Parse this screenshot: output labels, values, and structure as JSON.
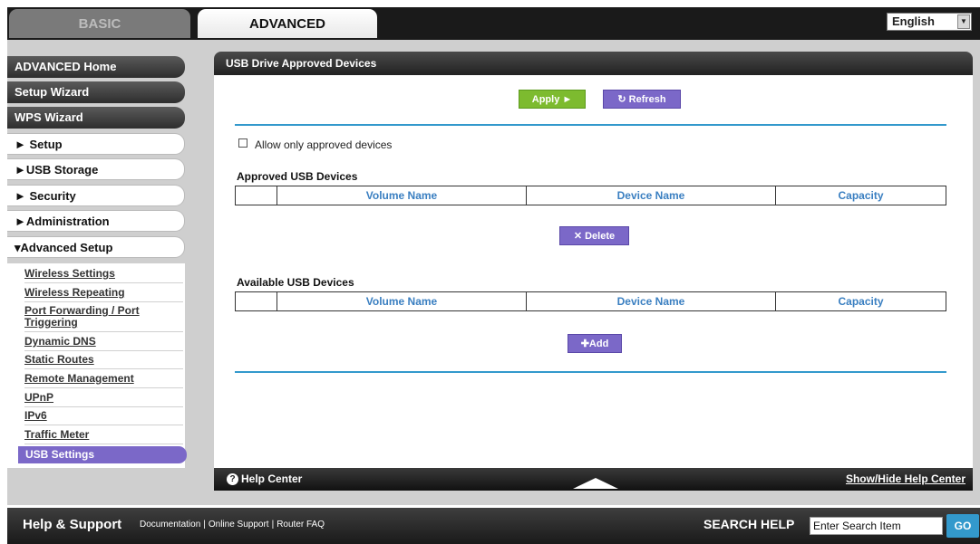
{
  "header": {
    "tabs": [
      {
        "label": "BASIC"
      },
      {
        "label": "ADVANCED"
      }
    ],
    "language": "English"
  },
  "sidebar": {
    "buttons": [
      {
        "label": "ADVANCED Home"
      },
      {
        "label": "Setup Wizard"
      },
      {
        "label": "WPS Wizard"
      },
      {
        "label": "► Setup"
      },
      {
        "label": "►USB Storage"
      },
      {
        "label": "► Security"
      },
      {
        "label": "►Administration"
      },
      {
        "label": "▾Advanced Setup"
      }
    ],
    "subitems": [
      {
        "label": "Wireless Settings"
      },
      {
        "label": "Wireless Repeating"
      },
      {
        "label": "Port Forwarding / Port Triggering"
      },
      {
        "label": "Dynamic DNS"
      },
      {
        "label": "Static Routes"
      },
      {
        "label": "Remote Management"
      },
      {
        "label": "UPnP"
      },
      {
        "label": "IPv6"
      },
      {
        "label": "Traffic Meter"
      },
      {
        "label": "USB Settings"
      }
    ]
  },
  "main": {
    "title": "USB Drive Approved Devices",
    "apply_label": "Apply ►",
    "refresh_label": "↻ Refresh",
    "allow_label": "Allow only approved devices",
    "approved_title": "Approved USB Devices",
    "available_title": "Available USB Devices",
    "columns": [
      "",
      "Volume Name",
      "Device Name",
      "Capacity"
    ],
    "delete_label": "✕ Delete",
    "add_label": "✚Add"
  },
  "help": {
    "label": "Help Center",
    "toggle": "Show/Hide Help Center"
  },
  "footer": {
    "title": "Help & Support",
    "links": [
      "Documentation",
      "Online Support",
      "Router FAQ"
    ],
    "search_label": "SEARCH HELP",
    "search_value": "Enter Search Item",
    "go_label": "GO"
  },
  "colors": {
    "accent_blue": "#3399cc",
    "purple": "#7b68c8",
    "green": "#7dbb2f",
    "dark": "#1a1a1a"
  }
}
